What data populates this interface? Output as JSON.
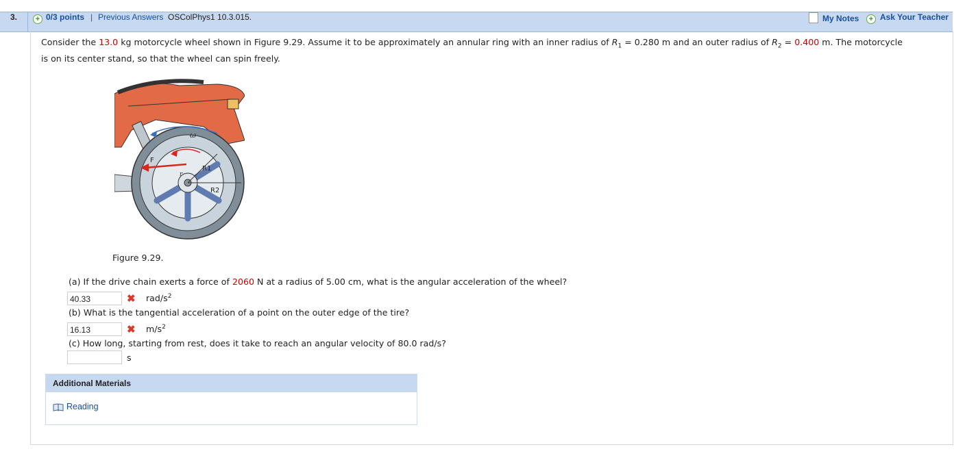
{
  "header": {
    "question_number": "3.",
    "points": "0/3 points",
    "separator": "|",
    "previous_answers": "Previous Answers",
    "code": "OSColPhys1 10.3.015.",
    "my_notes": "My Notes",
    "ask_teacher": "Ask Your Teacher"
  },
  "question": {
    "t1": "Consider the ",
    "mass": "13.0",
    "t2": " kg motorcycle wheel shown in Figure 9.29. Assume it to be approximately an annular ring with an inner radius of ",
    "r1_sym": "R",
    "r1_sub": "1",
    "t3": " = 0.280 m and an outer radius of ",
    "r2_sym": "R",
    "r2_sub": "2",
    "t4": " = ",
    "r2_val": "0.400",
    "t5": " m. The motorcycle",
    "line2": "is on its center stand, so that the wheel can spin freely."
  },
  "figure": {
    "caption": "Figure 9.29.",
    "labels": {
      "omega": "ω",
      "force": "F",
      "r": "r",
      "R1": "R1",
      "R2": "R2"
    },
    "colors": {
      "body": "#e36a47",
      "tire": "#7f8e98",
      "rim": "#c9d3dc",
      "spokes": "#5f7bb0",
      "arrow": "#d8261c"
    }
  },
  "parts": {
    "a_pre": "(a) If the drive chain exerts a force of ",
    "a_force": "2060",
    "a_post": " N at a radius of 5.00 cm, what is the angular acceleration of the wheel?",
    "a_value": "40.33",
    "a_unit": "rad/s",
    "a_unit_sup": "2",
    "b_text": "(b) What is the tangential acceleration of a point on the outer edge of the tire?",
    "b_value": "16.13",
    "b_unit": "m/s",
    "b_unit_sup": "2",
    "c_text": "(c) How long, starting from rest, does it take to reach an angular velocity of 80.0 rad/s?",
    "c_value": "",
    "c_unit": "s",
    "incorrect_mark": "✖"
  },
  "additional": {
    "title": "Additional Materials",
    "reading": "Reading"
  },
  "colors": {
    "header_bg": "#c6d9f1",
    "link": "#1a4fa0",
    "highlight": "#cc0000",
    "incorrect": "#d93b2b"
  }
}
